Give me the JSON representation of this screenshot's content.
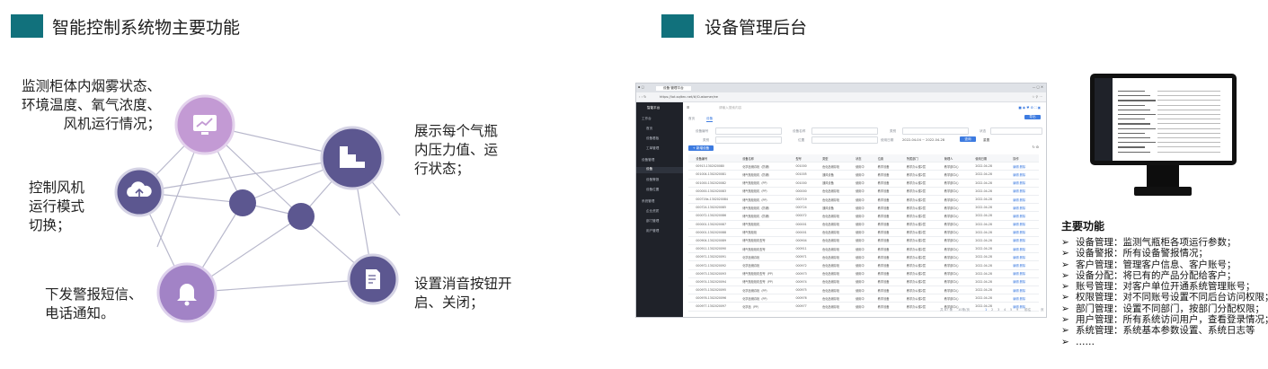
{
  "left_section": {
    "title": "智能控制系统物主要功能",
    "descriptions": {
      "monitor": [
        "监测柜体内烟雾状态、",
        "环境温度、氧气浓度、",
        "风机运行情况；"
      ],
      "display": [
        "展示每个气瓶",
        "内压力值、运",
        "行状态；"
      ],
      "fan": [
        "控制风机",
        "运行模式",
        "切换；"
      ],
      "alarm": [
        "下发警报短信、",
        "电话通知。"
      ],
      "mute": [
        "设置消音按钮开",
        "启、关闭；"
      ]
    },
    "icons": {
      "monitor": "monitor-chart-icon",
      "display": "cylinder-stairs-icon",
      "fan": "cloud-upload-icon",
      "alarm": "bell-icon",
      "mute": "document-edit-icon"
    },
    "colors": {
      "node_light": "#c59bd6",
      "node_dark": "#5c5790",
      "node_mid": "#a082c4",
      "edge": "#b3b3c8",
      "accent": "#11717c"
    }
  },
  "right_section": {
    "title": "设备管理后台",
    "browser": {
      "tab_label": "设备·管理平台",
      "url": "https://iot.sqltec.net/#/Customer/ee",
      "sidebar": {
        "logo": "智能平台",
        "items": [
          "工作台",
          "首页",
          "设备看板",
          "工单管理",
          "设备管理",
          "设备",
          "设备警报",
          "设备位置",
          "系统管理",
          "企业资质",
          "部门管理",
          "用户管理"
        ]
      },
      "tabs": [
        "首页",
        "设备"
      ],
      "search_placeholder": "请输入搜索内容",
      "filters": {
        "device_no": "设备编号",
        "device_name": "设备名称",
        "status": "状态",
        "type": "类别",
        "position": "位置",
        "date": "使用日期",
        "placeholder": "请输入",
        "date_range": "2022-04-04 ~ 2022-04-28",
        "search_button": "查询",
        "reset_button": "重置",
        "add_button": "+ 新增设备",
        "top_button": "导出"
      },
      "table": {
        "columns": [
          "",
          "设备编号",
          "设备名称",
          "型号",
          "类型",
          "状态",
          "位置",
          "所属部门",
          "管理人",
          "使用日期",
          "操作"
        ],
        "rows": [
          [
            "",
            "00913-1302020080",
            "化学品储存柜（防爆）",
            "001000",
            "危化品储存柜",
            "使用中",
            "教学设备",
            "教学办公楼2层",
            "教学部中心",
            "2022-04-28",
            "编辑 删除"
          ],
          [
            "",
            "001004-1302020081",
            "储气瓶柜柜机（防爆）",
            "001005",
            "通风设备",
            "使用中",
            "教学设备",
            "教学办公楼2层",
            "教学部中心",
            "2022-04-28",
            "编辑 删除"
          ],
          [
            "",
            "001000-1302020082",
            "储气瓶柜柜机（PP）",
            "001000",
            "通风设备",
            "使用中",
            "教学设备",
            "教学办公楼2层",
            "教学部中心",
            "2022-04-28",
            "编辑 删除"
          ],
          [
            "",
            "000000-1302020083",
            "储气瓶柜柜机（PP）",
            "000000",
            "危化品储存柜",
            "使用中",
            "教学设备",
            "教学办公楼2层",
            "教学部中心",
            "2022-04-28",
            "编辑 删除"
          ],
          [
            "",
            "000719a-1302020084",
            "储气瓶柜柜机（PP）",
            "000719",
            "危化品储存柜",
            "使用中",
            "教学设备",
            "教学办公楼2层",
            "教学部中心",
            "2022-04-28",
            "编辑 删除"
          ],
          [
            "",
            "000724-1302020085",
            "储气瓶柜柜机（防爆）",
            "000724",
            "通风设备",
            "使用中",
            "教学设备",
            "教学办公楼2层",
            "教学部中心",
            "2022-04-28",
            "编辑 删除"
          ],
          [
            "",
            "000072-1302020086",
            "储气瓶柜柜机（防爆）",
            "000072",
            "危化品储存柜",
            "使用中",
            "教学设备",
            "教学办公楼2层",
            "教学部中心",
            "2022-04-28",
            "编辑 删除"
          ],
          [
            "",
            "000001-1302020087",
            "储气瓶柜柜机",
            "000001",
            "危化品储存柜",
            "使用中",
            "教学设备",
            "教学办公楼2层",
            "教学部中心",
            "2022-04-28",
            "编辑 删除"
          ],
          [
            "",
            "000001-1302020088",
            "储气瓶柜柜",
            "000001",
            "危化品储存柜",
            "使用中",
            "教学设备",
            "教学办公楼2层",
            "教学部中心",
            "2022-04-28",
            "编辑 删除"
          ],
          [
            "",
            "000904-1302020089",
            "储气瓶柜柜机型号",
            "000904",
            "危化品储存柜",
            "使用中",
            "教学设备",
            "教学办公楼2层",
            "教学部中心",
            "2022-04-28",
            "编辑 删除"
          ],
          [
            "",
            "000911-1302020090",
            "储气瓶柜柜机型号",
            "000911",
            "危化品储存柜",
            "使用中",
            "教学设备",
            "教学办公楼2层",
            "教学部中心",
            "2022-04-28",
            "编辑 删除"
          ],
          [
            "",
            "000971-1302020091",
            "化学品储存柜",
            "000971",
            "危化品储存柜",
            "使用中",
            "教学设备",
            "教学办公楼2层",
            "教学部中心",
            "2022-04-28",
            "编辑 删除"
          ],
          [
            "",
            "000972-1302020092",
            "化学品储存柜",
            "000972",
            "危化品储存柜",
            "使用中",
            "教学设备",
            "教学办公楼2层",
            "教学部中心",
            "2022-04-28",
            "编辑 删除"
          ],
          [
            "",
            "000973-1302020093",
            "储气瓶柜柜机型号（PP）",
            "000973",
            "危化品储存柜",
            "使用中",
            "教学设备",
            "教学办公楼2层",
            "教学部中心",
            "2022-04-28",
            "编辑 删除"
          ],
          [
            "",
            "000974-1302020094",
            "储气瓶柜柜机型号（PP）",
            "000974",
            "危化品储存柜",
            "使用中",
            "教学设备",
            "教学办公楼2层",
            "教学部中心",
            "2022-04-28",
            "编辑 删除"
          ],
          [
            "",
            "000975-1302020095",
            "化学品储存柜（PP）",
            "000975",
            "危化品储存柜",
            "使用中",
            "教学设备",
            "教学办公楼2层",
            "教学部中心",
            "2022-04-28",
            "编辑 删除"
          ],
          [
            "",
            "000976-1302020096",
            "化学品储存柜（PP）",
            "000976",
            "危化品储存柜",
            "使用中",
            "教学设备",
            "教学办公楼2层",
            "教学部中心",
            "2022-04-28",
            "编辑 删除"
          ],
          [
            "",
            "000977-1302020097",
            "化学品（PP）",
            "000977",
            "危化品储存柜",
            "使用中",
            "教学设备",
            "教学办公楼2层",
            "教学部中心",
            "2022-04-28",
            "编辑 删除"
          ]
        ]
      },
      "pagination": {
        "total": "共 87 条",
        "per_page": "10条/页",
        "pages": [
          "1",
          "2",
          "3",
          "4",
          "5",
          "9"
        ],
        "goto": "前往",
        "page_unit": "页"
      }
    },
    "features": {
      "title": "主要功能",
      "bullet": "➢",
      "items": [
        "设备管理：监测气瓶柜各项运行参数；",
        "设备警报：所有设备警报情况；",
        "客户管理：管理客户信息、客户账号；",
        "设备分配：将已有的产品分配给客户；",
        "账号管理：对客户单位开通系统管理账号；",
        "权限管理：对不同账号设置不同后台访问权限；",
        "部门管理：设置不同部门，按部门分配权限；",
        "用户管理：所有系统访问用户，查看登录情况；",
        "系统管理：系统基本参数设置、系统日志等",
        "……"
      ]
    }
  }
}
